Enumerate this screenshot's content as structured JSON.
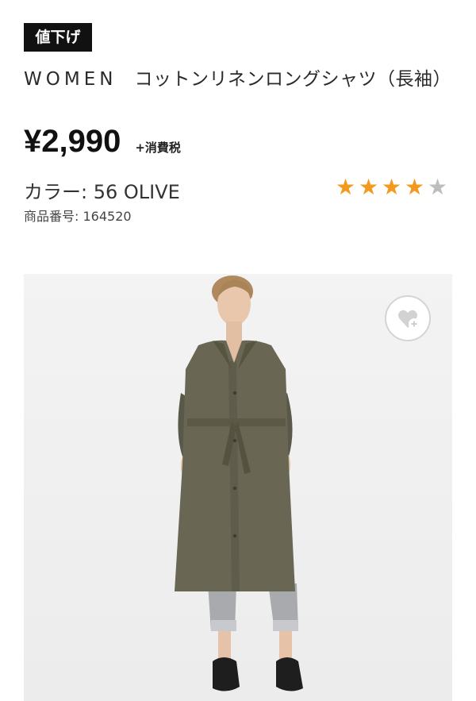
{
  "badge": {
    "label": "値下げ"
  },
  "product": {
    "gender": "WOMEN",
    "name": "コットンリネンロングシャツ（長袖）",
    "price": "¥2,990",
    "tax_note": "+消費税",
    "color_label": "カラー: 56 OLIVE",
    "product_number_label": "商品番号: 164520"
  },
  "rating": {
    "value": 4,
    "max": 5,
    "filled_color": "#f39a1e",
    "empty_color": "#bdbdbd"
  },
  "icons": {
    "favorite": "heart-plus-icon"
  }
}
